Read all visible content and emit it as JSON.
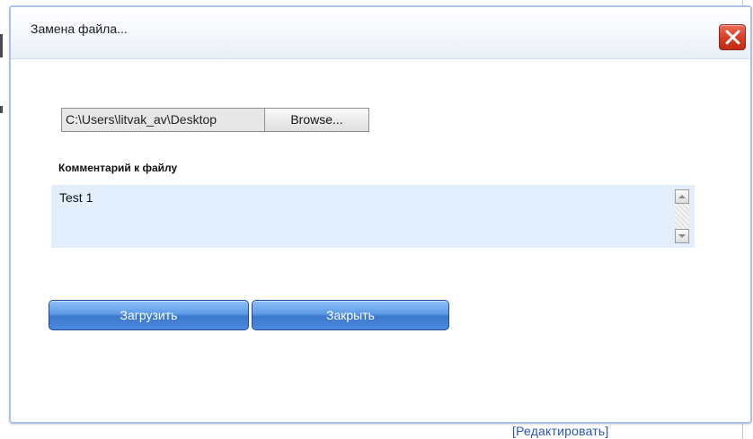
{
  "dialog": {
    "title": "Замена файла...",
    "close_icon": "close-icon",
    "file_path_value": "C:\\Users\\litvak_av\\Desktop",
    "browse_label": "Browse...",
    "comment_label": "Комментарий к файлу",
    "comment_value": "Test 1",
    "upload_button_label": "Загрузить",
    "close_button_label": "Закрыть"
  },
  "background": {
    "partial_link_text": "[Редактировать]"
  },
  "colors": {
    "button_blue": "#4c8ae0",
    "close_red": "#d63a23",
    "comment_bg": "#e2eefc",
    "titlebar_border": "#a8c2e2"
  }
}
